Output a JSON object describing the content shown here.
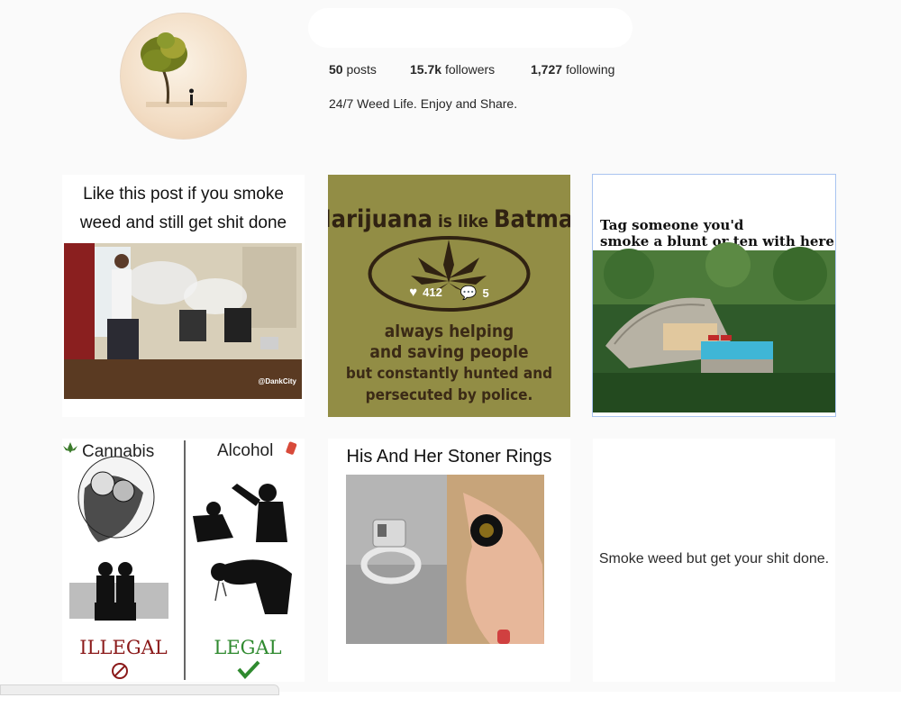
{
  "profile": {
    "stats": {
      "posts_count": "50",
      "posts_label": "posts",
      "followers_count": "15.7k",
      "followers_label": "followers",
      "following_count": "1,727",
      "following_label": "following"
    },
    "bio": "24/7 Weed Life. Enjoy and Share."
  },
  "posts": [
    {
      "caption_line1": "Like this post if you smoke",
      "caption_line2": "weed and still get shit done",
      "watermark": "@DankCity"
    },
    {
      "title_part1": "Marijuana",
      "title_part2": " is like ",
      "title_part3": "Batman",
      "line1": "always helping",
      "line2": "and saving people",
      "line3": "but constantly hunted and",
      "line4": "persecuted by police.",
      "likes": "412",
      "comments": "5"
    },
    {
      "caption_line1": "Tag someone you'd",
      "caption_line2": "smoke a blunt or ten with here"
    },
    {
      "left_header": "Cannabis",
      "right_header": "Alcohol",
      "left_footer": "ILLEGAL",
      "right_footer": "LEGAL"
    },
    {
      "title": "His And Her Stoner Rings"
    },
    {
      "text": "Smoke weed but get your shit done."
    }
  ],
  "icons": {
    "heart": "heart-icon",
    "comment": "comment-icon",
    "leaf": "cannabis-leaf-icon",
    "bottle": "bottle-icon",
    "check": "checkmark-icon",
    "no": "no-sign-icon"
  },
  "colors": {
    "background": "#fafafa",
    "text": "#262626",
    "batman_bg": "#b3ad55",
    "batman_text": "#3b2a16",
    "illegal_red": "#8b1a1a",
    "legal_green": "#2f8a2f",
    "selected_border": "#a9c4f0"
  }
}
